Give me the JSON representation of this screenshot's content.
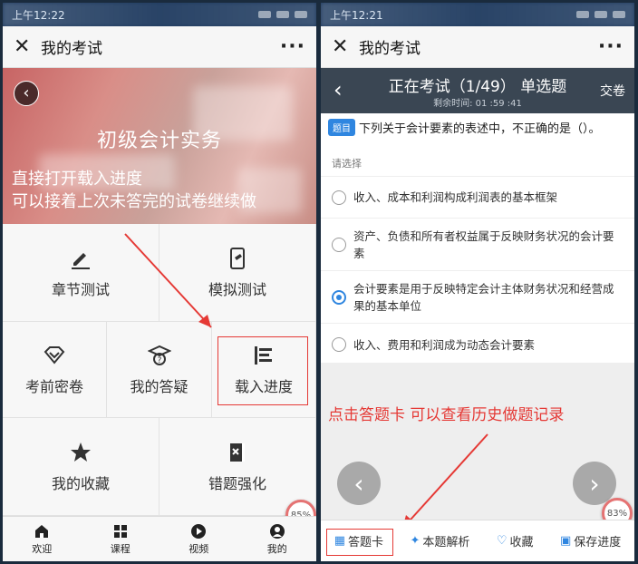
{
  "left": {
    "status_time": "上午12:22",
    "title": "我的考试",
    "more": "···",
    "course_title": "初级会计实务",
    "annotation_line1": "直接打开载入进度",
    "annotation_line2": "可以接着上次未答完的试卷继续做",
    "tiles": {
      "chapter": "章节测试",
      "mock": "模拟测试",
      "secret": "考前密卷",
      "qa": "我的答疑",
      "load": "载入进度",
      "fav": "我的收藏",
      "wrong": "错题强化"
    },
    "progress_badge": "85%",
    "tabs": [
      "欢迎",
      "课程",
      "视频",
      "我的"
    ]
  },
  "right": {
    "status_time": "上午12:21",
    "title": "我的考试",
    "more": "···",
    "exam_title": "正在考试（1/49） 单选题",
    "timer": "剩余时间: 01 :59 :41",
    "submit": "交卷",
    "question_tag": "题目",
    "question": "下列关于会计要素的表述中，不正确的是（）。",
    "please_choose": "请选择",
    "options": [
      "收入、成本和利润构成利润表的基本框架",
      "资产、负债和所有者权益属于反映财务状况的会计要素",
      "会计要素是用于反映特定会计主体财务状况和经营成果的基本单位",
      "收入、费用和利润成为动态会计要素"
    ],
    "selected_index": 2,
    "annotation": "点击答题卡  可以查看历史做题记录",
    "progress_badge": "83%",
    "bottom": {
      "card": "答题卡",
      "analysis": "本题解析",
      "fav": "收藏",
      "save": "保存进度"
    }
  },
  "colors": {
    "accent": "#2f86e0",
    "annotation": "#e53935",
    "exam_header": "#3a4653"
  }
}
